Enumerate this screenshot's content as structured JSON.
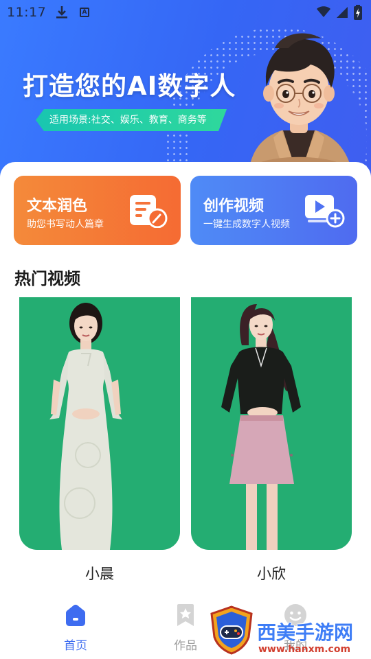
{
  "status_bar": {
    "time": "11:17"
  },
  "banner": {
    "title": "打造您的AI数字人",
    "tag": "适用场景:社交、娱乐、教育、商务等"
  },
  "features": [
    {
      "title": "文本润色",
      "subtitle": "助您书写动人篇章",
      "icon": "document-edit-icon",
      "color": "#f56b33"
    },
    {
      "title": "创作视频",
      "subtitle": "一键生成数字人视频",
      "icon": "video-add-icon",
      "color": "#4f6bf0"
    }
  ],
  "hot_videos": {
    "section_title": "热门视频",
    "items": [
      {
        "name": "小晨",
        "background": "#24ad72"
      },
      {
        "name": "小欣",
        "background": "#24ad72"
      }
    ]
  },
  "tab_bar": {
    "items": [
      {
        "label": "首页",
        "icon": "home-icon",
        "active": true
      },
      {
        "label": "作品",
        "icon": "star-bookmark-icon",
        "active": false
      },
      {
        "label": "我的",
        "icon": "smile-face-icon",
        "active": false
      }
    ],
    "active_color": "#3e6cf0"
  },
  "watermark": {
    "text": "西美手游网",
    "url": "www.hanxm.com"
  }
}
